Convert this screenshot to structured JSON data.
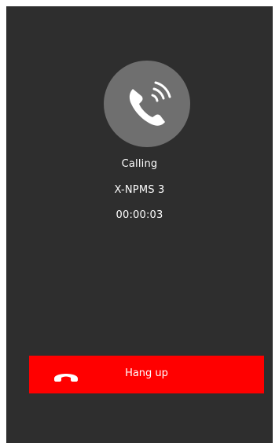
{
  "call": {
    "status": "Calling",
    "contact_name": "X-NPMS 3",
    "duration": "00:00:03"
  },
  "actions": {
    "hangup_label": "Hang up"
  },
  "icons": {
    "avatar": "phone-ringing-icon",
    "hangup": "phone-hangup-icon"
  },
  "colors": {
    "background": "#2e2e2e",
    "avatar_circle": "#6f6f6f",
    "hangup_button": "#ff0000",
    "text": "#ffffff"
  }
}
